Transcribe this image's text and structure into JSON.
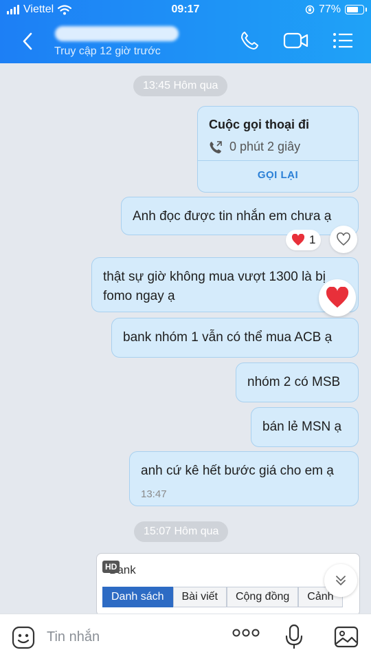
{
  "status_bar": {
    "carrier": "Viettel",
    "time": "09:17",
    "battery": "77%",
    "battery_level": 0.77
  },
  "header": {
    "last_seen": "Truy cập 12 giờ trước"
  },
  "chat": {
    "time_1": "13:45 Hôm qua",
    "call_card": {
      "title": "Cuộc gọi thoại đi",
      "duration": "0 phút 2 giây",
      "callback_label": "GỌI LẠI"
    },
    "messages": [
      "Anh đọc được tin nhắn em chưa ạ",
      "thật sự giờ không mua vượt 1300 là bị fomo ngay ạ",
      "bank nhóm 1 vẫn có thể mua ACB ạ",
      "nhóm 2 có MSB",
      "bán lẻ MSN ạ",
      "anh cứ kê hết bước giá cho em ạ"
    ],
    "reaction_count": "1",
    "msg_timestamp": "13:47",
    "time_2": "15:07 Hôm qua",
    "image": {
      "hd_badge": "HD",
      "title": "Bank",
      "tabs": [
        "Danh sách",
        "Bài viết",
        "Cộng đồng",
        "Cảnh"
      ]
    }
  },
  "input": {
    "placeholder": "Tin nhắn",
    "more_label": "ooo"
  },
  "colors": {
    "header_start": "#1d7ff5",
    "header_end": "#1fa2f7",
    "bubble": "#d5ebfb",
    "heart": "#e8303a",
    "accent": "#2a7fd6"
  }
}
